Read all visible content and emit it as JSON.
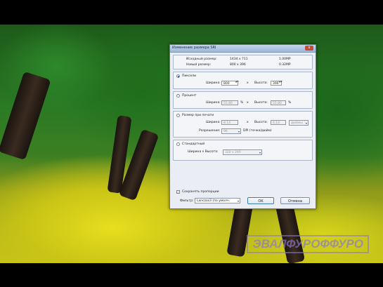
{
  "dialog": {
    "title": "Изменение размера SRI",
    "close_label": "x",
    "info": {
      "original_label": "Исходный размер:",
      "original_dims": "1434 x 711",
      "original_size": "1.00MP",
      "new_label": "Новый размер:",
      "new_dims": "800 x 396",
      "new_size": "0.32MP"
    },
    "pixels": {
      "label": "Пиксели",
      "selected": true,
      "width_label": "Ширина:",
      "width_value": "800",
      "x_label": "x",
      "height_label": "Высота:",
      "height_value": "396"
    },
    "percent": {
      "label": "Процент",
      "selected": false,
      "width_label": "Ширина:",
      "width_value": "55.80",
      "pct1": "%",
      "x_label": "x",
      "height_label": "Высота:",
      "height_value": "55.80",
      "pct2": "%"
    },
    "print": {
      "label": "Размер при печати",
      "selected": false,
      "width_label": "Ширина:",
      "width_value": "8.14",
      "x_label": "x",
      "height_label": "Высота:",
      "height_value": "4.14",
      "unit": "дюймы",
      "resolution_label": "Разрешение:",
      "resolution_value": "96",
      "dpi_label": "DPI (точка/дюйм)"
    },
    "standard": {
      "label": "Стандартный",
      "selected": false,
      "size_label": "Ширина x Высота:",
      "size_value": "320 x 240"
    },
    "keep_ratio": {
      "label": "Сохранять пропорции",
      "checked": true,
      "mark": "✓"
    },
    "filter": {
      "label": "Фильтр:",
      "value": "Lanczos3 (по умолч."
    },
    "ok_label": "OK",
    "cancel_label": "Отмена"
  },
  "watermark": "ЭВАЛФУРОФФУРО",
  "icons": {
    "spin": "▲▼",
    "dropdown": "▾"
  }
}
